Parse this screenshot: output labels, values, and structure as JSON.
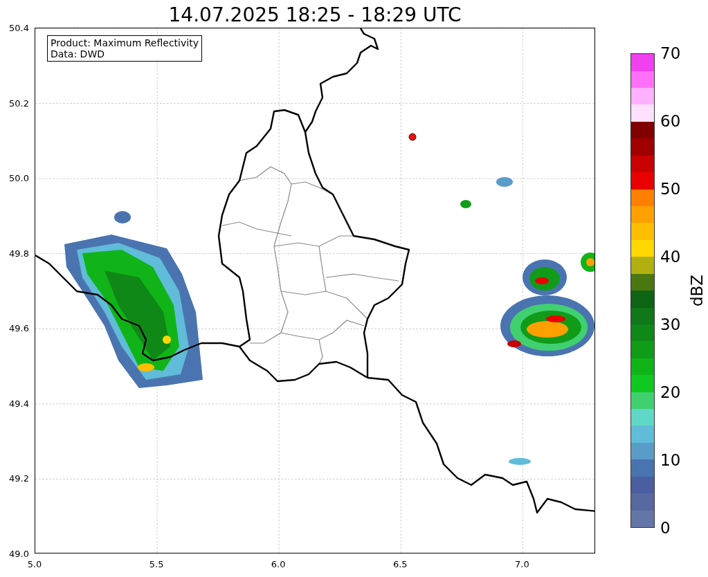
{
  "title": "14.07.2025 18:25 - 18:29 UTC",
  "info_box": {
    "lines": [
      "Product: Maximum Reflectivity",
      "Data: DWD"
    ]
  },
  "map": {
    "x_ticks": [
      "5.0",
      "5.5",
      "6.0",
      "6.5",
      "7.0"
    ],
    "y_ticks": [
      "50.4",
      "50.2",
      "50.0",
      "49.8",
      "49.6",
      "49.4",
      "49.2",
      "49.0"
    ]
  },
  "colorbar": {
    "label": "dBZ",
    "ticks": [
      "70",
      "60",
      "50",
      "40",
      "30",
      "20",
      "10",
      "0"
    ],
    "segments": [
      {
        "color": "#6476a8"
      },
      {
        "color": "#5868a0"
      },
      {
        "color": "#4a5ea0"
      },
      {
        "color": "#4a74b0"
      },
      {
        "color": "#5a9cc8"
      },
      {
        "color": "#60bcd8"
      },
      {
        "color": "#60d8c8"
      },
      {
        "color": "#40d070"
      },
      {
        "color": "#10c820"
      },
      {
        "color": "#10b418"
      },
      {
        "color": "#109c18"
      },
      {
        "color": "#108818"
      },
      {
        "color": "#107818"
      },
      {
        "color": "#0c6414"
      },
      {
        "color": "#4a7810"
      },
      {
        "color": "#b0b010"
      },
      {
        "color": "#ffd800"
      },
      {
        "color": "#ffbe00"
      },
      {
        "color": "#ffa000"
      },
      {
        "color": "#ff8000"
      },
      {
        "color": "#e80000"
      },
      {
        "color": "#c80000"
      },
      {
        "color": "#a00000"
      },
      {
        "color": "#800000"
      },
      {
        "color": "#ffe0ff"
      },
      {
        "color": "#ffb0ff"
      },
      {
        "color": "#ff70f8"
      },
      {
        "color": "#f040f0"
      }
    ]
  }
}
